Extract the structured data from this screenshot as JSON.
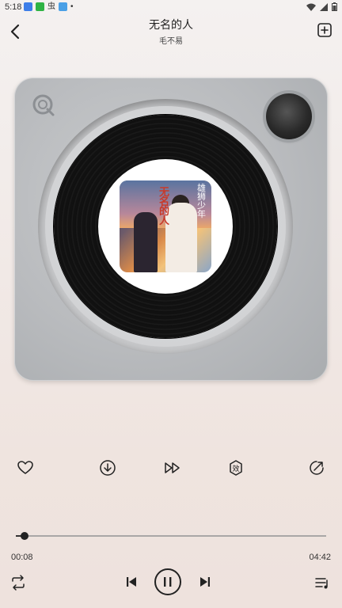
{
  "status_bar": {
    "time": "5:18",
    "app_icons": [
      "mail-icon",
      "app-green-icon",
      "bug-icon",
      "app-blue-icon",
      "dot-icon"
    ],
    "right_icons": [
      "wifi-icon",
      "signal-icon",
      "battery-icon"
    ]
  },
  "header": {
    "title": "无名的人",
    "artist": "毛不易",
    "back_icon": "chevron-left-icon",
    "add_icon": "add-square-icon"
  },
  "player": {
    "style": "vinyl-record-player",
    "colors": {
      "body": "#b9bbbe",
      "vinyl": "#111111",
      "accent_title": "#c83a2a"
    },
    "cover_text": {
      "title": "无名的人",
      "side_text": "雄狮少年"
    }
  },
  "actions": [
    {
      "name": "like",
      "icon": "heart-icon"
    },
    {
      "name": "download",
      "icon": "download-icon"
    },
    {
      "name": "speed",
      "icon": "fast-forward-icon"
    },
    {
      "name": "effects",
      "icon": "sound-effect-icon"
    },
    {
      "name": "share",
      "icon": "share-icon"
    }
  ],
  "progress": {
    "current": "00:08",
    "total": "04:42",
    "fraction": 0.028
  },
  "controls": [
    {
      "name": "repeat",
      "icon": "repeat-icon"
    },
    {
      "name": "previous",
      "icon": "skip-previous-icon"
    },
    {
      "name": "play-pause",
      "icon": "pause-icon"
    },
    {
      "name": "next",
      "icon": "skip-next-icon"
    },
    {
      "name": "playlist",
      "icon": "playlist-icon"
    }
  ]
}
